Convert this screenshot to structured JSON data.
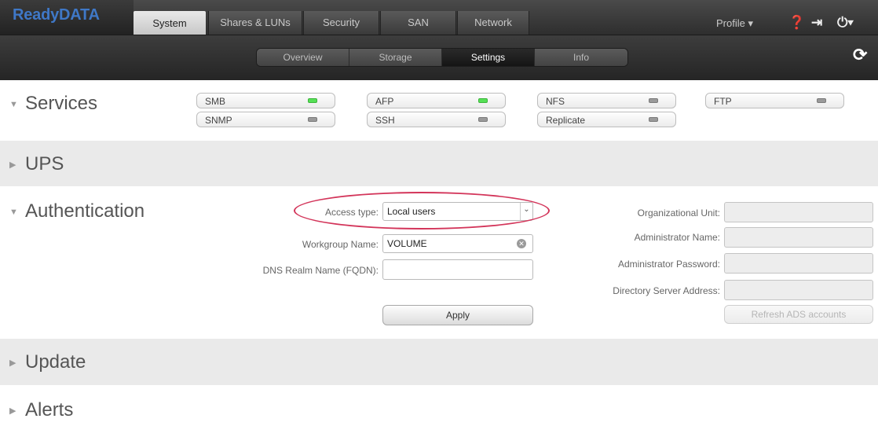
{
  "app": {
    "logo": "ReadyDATA"
  },
  "top_tabs": [
    {
      "label": "System"
    },
    {
      "label": "Shares & LUNs"
    },
    {
      "label": "Security"
    },
    {
      "label": "SAN"
    },
    {
      "label": "Network"
    }
  ],
  "profile": {
    "label": "Profile ▾"
  },
  "sub_tabs": [
    {
      "label": "Overview"
    },
    {
      "label": "Storage"
    },
    {
      "label": "Settings"
    },
    {
      "label": "Info"
    }
  ],
  "sections": {
    "services": "Services",
    "ups": "UPS",
    "authentication": "Authentication",
    "update": "Update",
    "alerts": "Alerts"
  },
  "services": [
    {
      "name": "SMB",
      "status": "on"
    },
    {
      "name": "AFP",
      "status": "on"
    },
    {
      "name": "NFS",
      "status": "off"
    },
    {
      "name": "FTP",
      "status": "off"
    },
    {
      "name": "SNMP",
      "status": "off"
    },
    {
      "name": "SSH",
      "status": "off"
    },
    {
      "name": "Replicate",
      "status": "off"
    }
  ],
  "auth": {
    "access_type_label": "Access type:",
    "access_type_value": "Local users",
    "workgroup_label": "Workgroup Name:",
    "workgroup_value": "VOLUME",
    "dns_realm_label": "DNS Realm Name (FQDN):",
    "dns_realm_value": "",
    "apply_label": "Apply",
    "org_unit_label": "Organizational Unit:",
    "admin_name_label": "Administrator Name:",
    "admin_password_label": "Administrator Password:",
    "dir_server_label": "Directory Server Address:",
    "refresh_ads_label": "Refresh ADS accounts"
  },
  "colors": {
    "led_on": "#55e055",
    "led_off": "#9a9a9a",
    "highlight": "#d3355a",
    "logo": "#3f78c7"
  }
}
